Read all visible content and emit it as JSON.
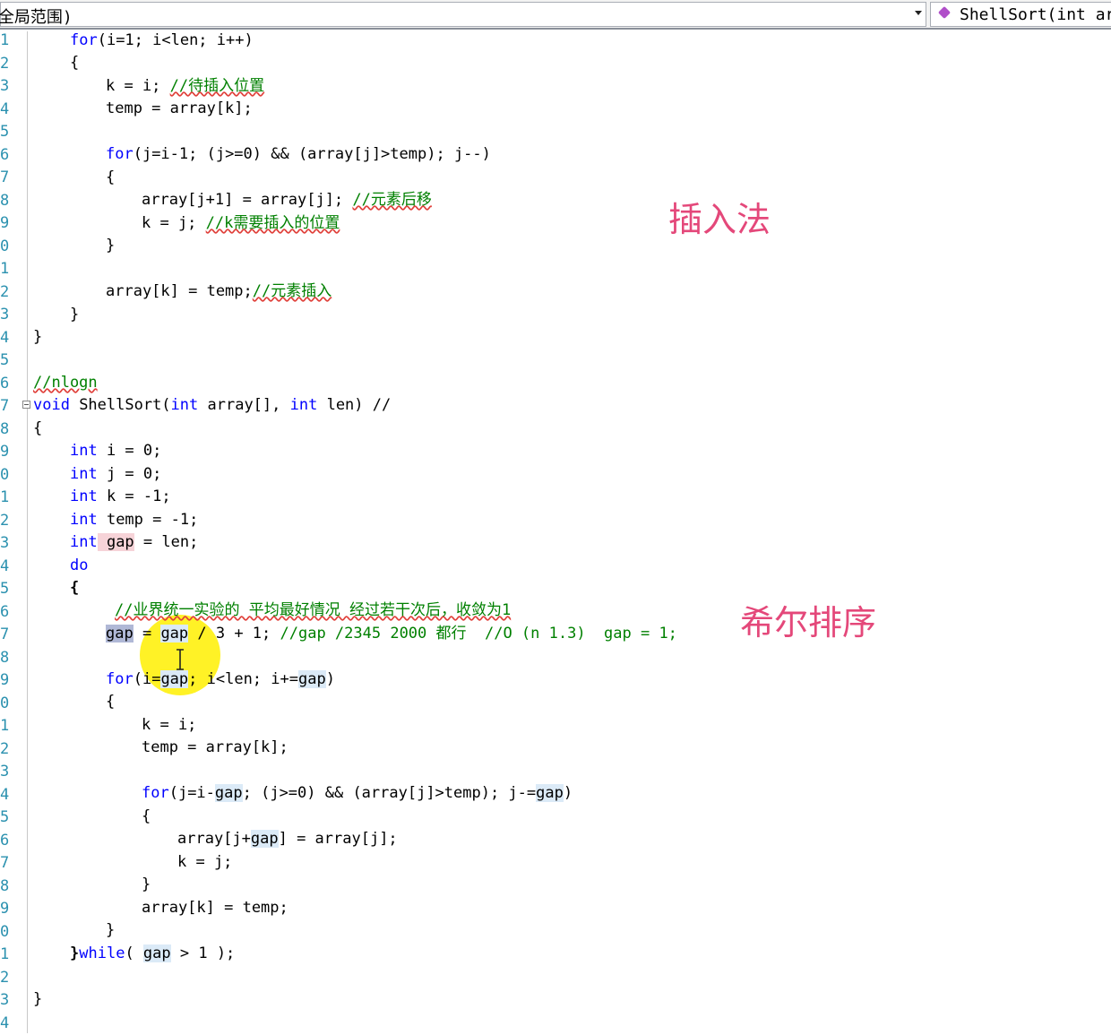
{
  "toolbar": {
    "scope_label": "(全局范围)",
    "function_label": "ShellSort(int ar"
  },
  "annotations": {
    "insertion": "插入法",
    "shell": "希尔排序"
  },
  "line_numbers": [
    "1",
    "2",
    "3",
    "4",
    "5",
    "6",
    "7",
    "8",
    "9",
    "0",
    "1",
    "2",
    "3",
    "4",
    "5",
    "6",
    "7",
    "8",
    "9",
    "0",
    "1",
    "2",
    "3",
    "4",
    "5",
    "6",
    "7",
    "8",
    "9",
    "0",
    "1",
    "2",
    "3",
    "4",
    "5",
    "6",
    "7",
    "8",
    "9",
    "0",
    "1",
    "2",
    "3",
    "4"
  ],
  "code": {
    "l1_a": "for",
    "l1_b": "(i=1; i<len; i++)",
    "l2": "{",
    "l3_a": "k = i; ",
    "l3_c": "//待插入位置",
    "l4": "temp = array[k];",
    "l6_a": "for",
    "l6_b": "(j=i-1; (j>=0) && (array[j]>temp); j--)",
    "l7": "{",
    "l8_a": "array[j+1] = array[j]; ",
    "l8_c": "//元素后移",
    "l9_a": "k = j; ",
    "l9_c": "//k需要插入的位置",
    "l10": "}",
    "l12_a": "array[k] = temp;",
    "l12_c": "//元素插入",
    "l13": "}",
    "l14": "}",
    "l16": "//nlogn",
    "l17_a": "void",
    "l17_b": " ShellSort(",
    "l17_c": "int",
    "l17_d": " array[], ",
    "l17_e": "int",
    "l17_f": " len) //",
    "l18": "{",
    "l19_a": "int",
    "l19_b": " i = 0;",
    "l20_a": "int",
    "l20_b": " j = 0;",
    "l21_a": "int",
    "l21_b": " k = -1;",
    "l22_a": "int",
    "l22_b": " temp = -1;",
    "l23_a": "int",
    "l23_b": " gap",
    "l23_c": " = len;",
    "l24": "do",
    "l25": "{",
    "l26": "//业界统一实验的 平均最好情况 经过若干次后，收敛为1",
    "l27_a": "gap",
    "l27_b": " = ",
    "l27_c": "gap",
    "l27_d": " / 3 + 1; ",
    "l27_e": "//gap /2345 2000 都行  //O (n 1.3)  gap = 1;",
    "l29_a": "for",
    "l29_b": "(i=",
    "l29_c": "gap",
    "l29_d": "; i<len; i+=",
    "l29_e": "gap",
    "l29_f": ")",
    "l30": "{",
    "l31": "k = i;",
    "l32": "temp = array[k];",
    "l34_a": "for",
    "l34_b": "(j=i-",
    "l34_c": "gap",
    "l34_d": "; (j>=0) && (array[j]>temp); j-=",
    "l34_e": "gap",
    "l34_f": ")",
    "l35": "{",
    "l36_a": "array[j+",
    "l36_b": "gap",
    "l36_c": "] = array[j];",
    "l37": "k = j;",
    "l38": "}",
    "l39": "array[k] = temp;",
    "l40": "}",
    "l41_a": "}",
    "l41_b": "while",
    "l41_c": "( ",
    "l41_d": "gap",
    "l41_e": " > 1 );",
    "l43": "}"
  }
}
